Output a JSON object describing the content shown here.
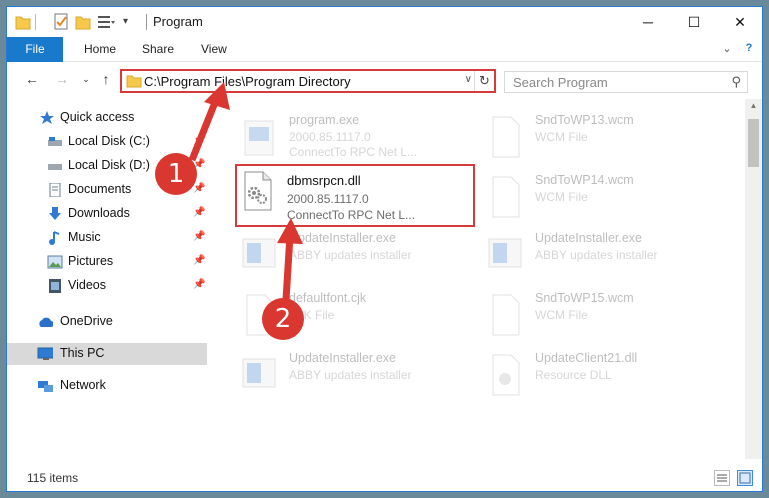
{
  "window": {
    "title": "Program",
    "minimize_icon": "minimize-icon",
    "maximize_icon": "maximize-icon",
    "close_icon": "close-icon"
  },
  "ribbon": {
    "tabs": [
      {
        "label": "File"
      },
      {
        "label": "Home"
      },
      {
        "label": "Share"
      },
      {
        "label": "View"
      }
    ]
  },
  "address": {
    "path": "C:\\Program Files\\Program Directory"
  },
  "search": {
    "placeholder": "Search Program"
  },
  "sidebar": {
    "items": [
      {
        "label": "Quick access",
        "icon": "star-icon"
      },
      {
        "label": "Local Disk (C:)",
        "icon": "drive-icon"
      },
      {
        "label": "Local Disk (D:)",
        "icon": "drive-icon"
      },
      {
        "label": "Documents",
        "icon": "documents-icon"
      },
      {
        "label": "Downloads",
        "icon": "download-icon"
      },
      {
        "label": "Music",
        "icon": "music-icon"
      },
      {
        "label": "Pictures",
        "icon": "pictures-icon"
      },
      {
        "label": "Videos",
        "icon": "videos-icon"
      },
      {
        "label": "OneDrive",
        "icon": "cloud-icon"
      },
      {
        "label": "This PC",
        "icon": "computer-icon"
      },
      {
        "label": "Network",
        "icon": "network-icon"
      }
    ]
  },
  "files": [
    {
      "name": "program.exe",
      "line1": "2000.85.1117.0",
      "line2": "ConnectTo RPC Net L..."
    },
    {
      "name": "SndToWP13.wcm",
      "line1": "WCM File",
      "line2": ""
    },
    {
      "name": "dbmsrpcn.dll",
      "line1": "2000.85.1117.0",
      "line2": "ConnectTo RPC Net L..."
    },
    {
      "name": "SndToWP14.wcm",
      "line1": "WCM File",
      "line2": ""
    },
    {
      "name": "UpdateInstaller.exe",
      "line1": "ABBY updates installer",
      "line2": ""
    },
    {
      "name": "UpdateInstaller.exe",
      "line1": "ABBY updates installer",
      "line2": ""
    },
    {
      "name": "defaultfont.cjk",
      "line1": "CJK File",
      "line2": ""
    },
    {
      "name": "SndToWP15.wcm",
      "line1": "WCM File",
      "line2": ""
    },
    {
      "name": "UpdateInstaller.exe",
      "line1": "ABBY updates installer",
      "line2": ""
    },
    {
      "name": "UpdateClient21.dll",
      "line1": "Resource DLL",
      "line2": ""
    }
  ],
  "status": {
    "count": "115 items"
  },
  "callouts": {
    "one": "1",
    "two": "2"
  },
  "colors": {
    "accent": "#1979ca",
    "highlight": "#d63a3a"
  }
}
